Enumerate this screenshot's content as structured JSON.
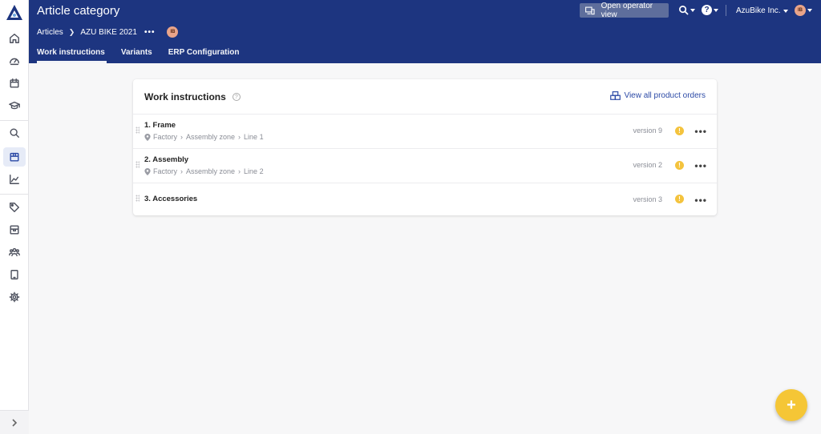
{
  "header": {
    "title": "Article category",
    "breadcrumb": [
      "Articles",
      "AZU BIKE 2021"
    ],
    "breadcrumb_more": "•••",
    "avatar_initials": "IB",
    "tabs": [
      "Work instructions",
      "Variants",
      "ERP Configuration"
    ],
    "operator_button": "Open operator view",
    "company": "AzuBike Inc.",
    "help_label": "?",
    "user_initials": "IB"
  },
  "card": {
    "title": "Work instructions",
    "help_label": "?",
    "view_all": "View all product orders",
    "rows": [
      {
        "name": "1. Frame",
        "location": [
          "Factory",
          "Assembly zone",
          "Line 1"
        ],
        "version": "version 9",
        "warn": "!"
      },
      {
        "name": "2. Assembly",
        "location": [
          "Factory",
          "Assembly zone",
          "Line 2"
        ],
        "version": "version 2",
        "warn": "!"
      },
      {
        "name": "3. Accessories",
        "version": "version 3",
        "warn": "!"
      }
    ],
    "more_label": "•••"
  },
  "fab_label": "+",
  "icons": {
    "sidebar": [
      "home-icon",
      "speedometer-icon",
      "calendar-icon",
      "graduation-cap-icon",
      "search-icon",
      "box-icon",
      "chart-icon",
      "tags-icon",
      "archive-icon",
      "users-icon",
      "tablet-icon",
      "gear-icon",
      "chevron-right-icon"
    ]
  },
  "colors": {
    "header_bg": "#1d3580",
    "accent": "#2c4aa6",
    "warning": "#f4c33d",
    "fab": "#f5c636"
  }
}
